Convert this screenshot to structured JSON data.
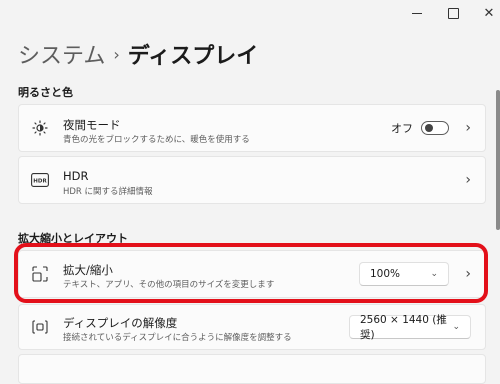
{
  "window": {
    "minimize_icon": "minimize-icon",
    "maximize_icon": "maximize-icon",
    "close_icon": "close-icon"
  },
  "breadcrumb": {
    "parent": "システム",
    "separator": "›",
    "current": "ディスプレイ"
  },
  "sections": {
    "brightness": {
      "title": "明るさと色"
    },
    "scale": {
      "title": "拡大縮小とレイアウト"
    }
  },
  "nightlight": {
    "title": "夜間モード",
    "description": "青色の光をブロックするために、暖色を使用する",
    "toggle_label": "オフ",
    "toggle_on": false,
    "icon": "brightness-icon"
  },
  "hdr": {
    "title": "HDR",
    "description": "HDR に関する詳細情報",
    "icon_text": "HDR"
  },
  "scale_item": {
    "title": "拡大/縮小",
    "description": "テキスト、アプリ、その他の項目のサイズを変更します",
    "selected": "100%",
    "icon": "scale-icon"
  },
  "resolution": {
    "title": "ディスプレイの解像度",
    "description": "接続されているディスプレイに合うように解像度を調整する",
    "selected": "2560 × 1440 (推奨)",
    "icon": "resolution-icon"
  },
  "colors": {
    "highlight": "#e3101a",
    "background": "#f3f3f3",
    "card": "#fbfbfb"
  }
}
